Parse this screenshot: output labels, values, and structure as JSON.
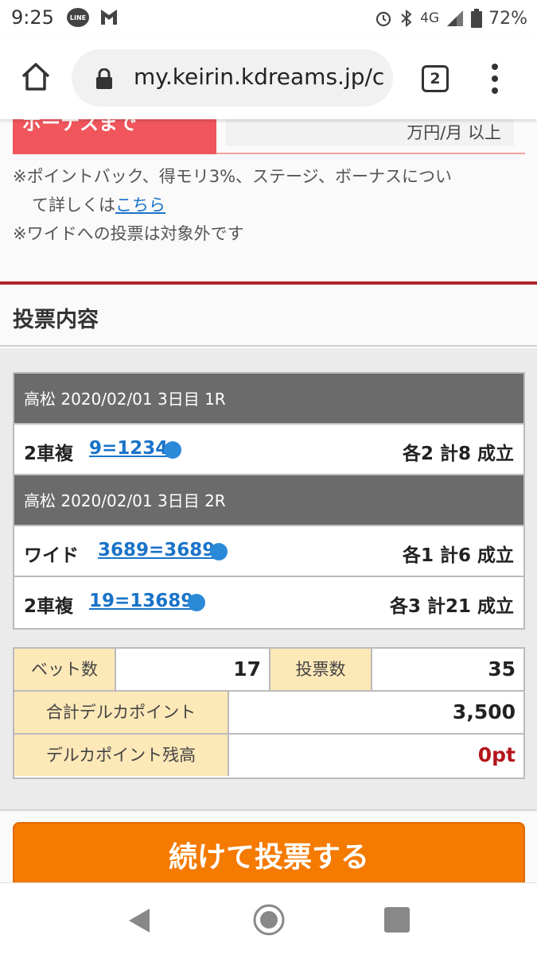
{
  "status_bar": {
    "time": "9:25",
    "line_app": "LINE",
    "network": "4G",
    "battery": "72%"
  },
  "browser": {
    "url": "my.keirin.kdreams.jp/c",
    "tab_count": "2"
  },
  "bonus": {
    "label": "ボーナスまで",
    "value": "万円/月 以上"
  },
  "notes": {
    "line1_prefix": "※ポイントバック、得モリ3%、ステージ、ボーナスについ",
    "line1_cont": "て詳しくは",
    "line1_link": "こちら",
    "line2": "※ワイドへの投票は対象外です"
  },
  "section_title": "投票内容",
  "races": [
    {
      "header": "高松 2020/02/01 3日目 1R",
      "bets": [
        {
          "type": "2車複",
          "combo": "9=1234",
          "summary": "各2 計8 成立"
        }
      ]
    },
    {
      "header": "高松 2020/02/01 3日目 2R",
      "bets": [
        {
          "type": "ワイド",
          "combo": "3689=3689",
          "summary": "各1 計6 成立"
        },
        {
          "type": "2車複",
          "combo": "19=13689",
          "summary": "各3 計21 成立"
        }
      ]
    }
  ],
  "totals": {
    "bet_count_label": "ベット数",
    "bet_count": "17",
    "vote_count_label": "投票数",
    "vote_count": "35",
    "total_points_label": "合計デルカポイント",
    "total_points": "3,500",
    "balance_label": "デルカポイント残高",
    "balance": "0pt"
  },
  "continue_button": "続けて投票する",
  "colors": {
    "accent_red": "#b3161c",
    "button_orange": "#f47a00",
    "link_blue": "#1a73c8",
    "label_yellow": "#fde8b8"
  }
}
